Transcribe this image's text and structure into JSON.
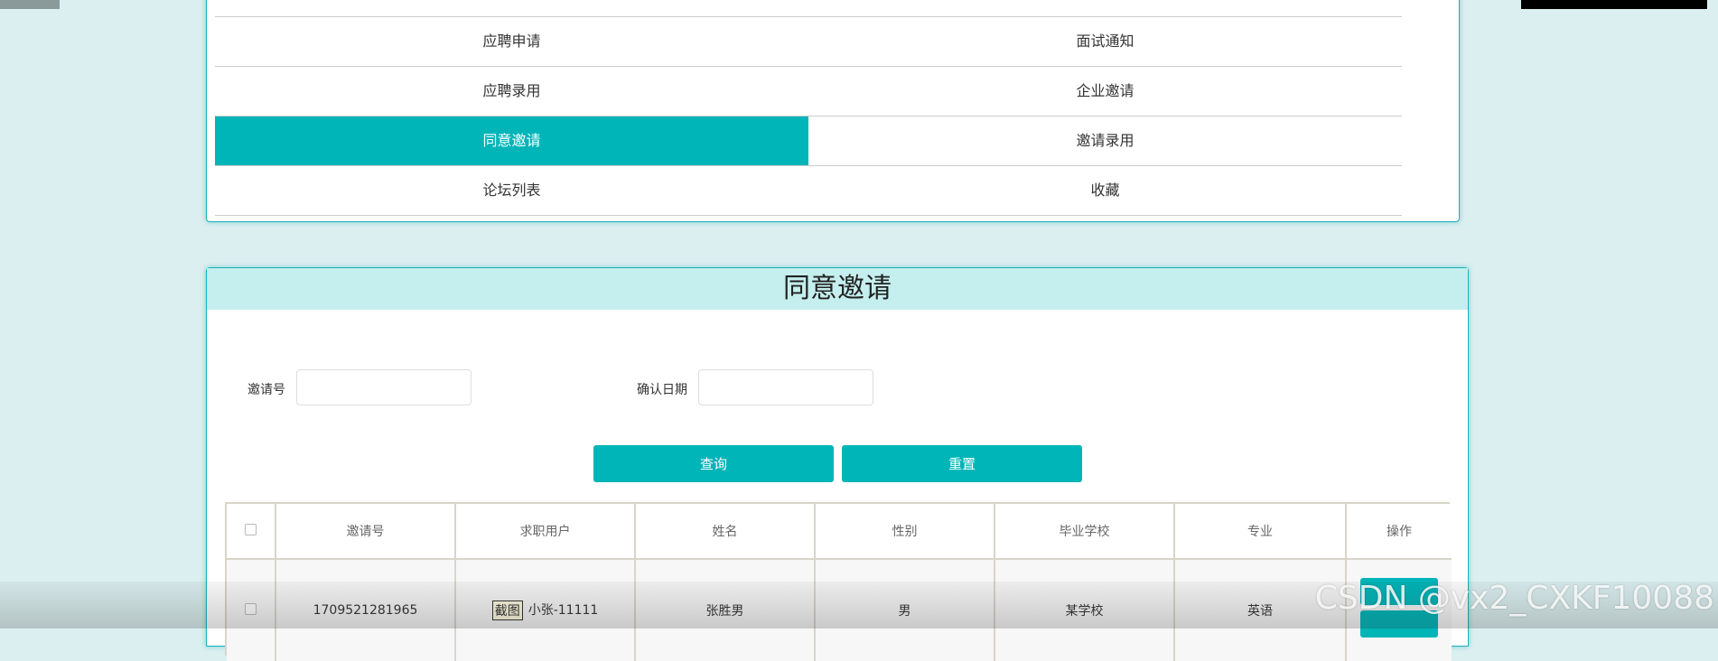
{
  "menu": {
    "items": [
      {
        "label": "应聘申请"
      },
      {
        "label": "面试通知"
      },
      {
        "label": "应聘录用"
      },
      {
        "label": "企业邀请"
      },
      {
        "label": "同意邀请",
        "active": true
      },
      {
        "label": "邀请录用"
      },
      {
        "label": "论坛列表"
      },
      {
        "label": "收藏"
      }
    ]
  },
  "page": {
    "title": "同意邀请"
  },
  "search": {
    "invite_no_label": "邀请号",
    "invite_no_value": "",
    "confirm_date_label": "确认日期",
    "confirm_date_value": "",
    "query_button": "查询",
    "reset_button": "重置"
  },
  "table": {
    "headers": [
      "邀请号",
      "求职用户",
      "姓名",
      "性别",
      "毕业学校",
      "专业",
      "操作"
    ],
    "rows": [
      {
        "invite_no": "1709521281965",
        "screenshot_badge": "截图",
        "job_user": "小张-11111",
        "name": "张胜男",
        "gender": "男",
        "school": "某学校",
        "major": "英语"
      }
    ]
  },
  "watermark": "CSDN @vx2_CXKF10088",
  "colors": {
    "accent": "#00b5b8",
    "header_bg": "#c5efee",
    "page_bg": "#dbeff0"
  }
}
